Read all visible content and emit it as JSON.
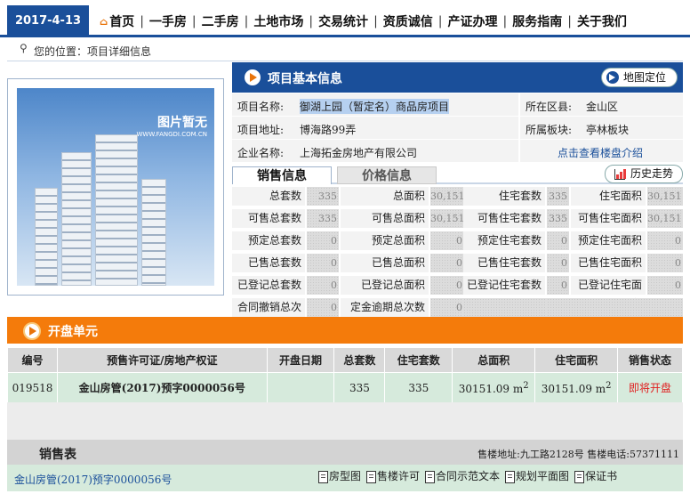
{
  "date": "2017-4-13",
  "nav": [
    "首页",
    "一手房",
    "二手房",
    "土地市场",
    "交易统计",
    "资质诚信",
    "产证办理",
    "服务指南",
    "关于我们"
  ],
  "breadcrumb": "您的位置：项目详细信息",
  "photo": {
    "caption": "图片暂无",
    "sub": "WWW.FANGDI.COM.CN"
  },
  "info": {
    "title": "项目基本信息",
    "map_btn": "地图定位",
    "rows": [
      {
        "l": "项目名称:",
        "v": "御湖上园（暂定名）商品房项目",
        "l2": "所在区县:",
        "v2": "金山区"
      },
      {
        "l": "项目地址:",
        "v": "博海路99弄",
        "l2": "所属板块:",
        "v2": "亭林板块"
      },
      {
        "l": "企业名称:",
        "v": "上海拓金房地产有限公司",
        "l2": "",
        "v2": "点击查看楼盘介绍"
      }
    ]
  },
  "tabs": {
    "sales": "销售信息",
    "price": "价格信息",
    "history": "历史走势"
  },
  "stats": [
    [
      [
        "总套数",
        "335"
      ],
      [
        "总面积",
        "30,151"
      ],
      [
        "住宅套数",
        "335"
      ],
      [
        "住宅面积",
        "30,151"
      ]
    ],
    [
      [
        "可售总套数",
        "335"
      ],
      [
        "可售总面积",
        "30,151"
      ],
      [
        "可售住宅套数",
        "335"
      ],
      [
        "可售住宅面积",
        "30,151"
      ]
    ],
    [
      [
        "预定总套数",
        "0"
      ],
      [
        "预定总面积",
        "0"
      ],
      [
        "预定住宅套数",
        "0"
      ],
      [
        "预定住宅面积",
        "0"
      ]
    ],
    [
      [
        "已售总套数",
        "0"
      ],
      [
        "已售总面积",
        "0"
      ],
      [
        "已售住宅套数",
        "0"
      ],
      [
        "已售住宅面积",
        "0"
      ]
    ],
    [
      [
        "已登记总套数",
        "0"
      ],
      [
        "已登记总面积",
        "0"
      ],
      [
        "已登记住宅套数",
        "0"
      ],
      [
        "已登记住宅面积",
        "0"
      ]
    ],
    [
      [
        "合同撤销总次数",
        "0"
      ],
      [
        "定金逾期总次数",
        "0"
      ]
    ]
  ],
  "opening": {
    "title": "开盘单元",
    "headers": [
      "编号",
      "预售许可证/房地产权证",
      "开盘日期",
      "总套数",
      "住宅套数",
      "总面积",
      "住宅面积",
      "销售状态"
    ],
    "row": {
      "id": "019518",
      "permit": "金山房管(2017)预字0000056号",
      "date": "",
      "total": "335",
      "res": "335",
      "area": "30151.09 m",
      "res_area": "30151.09 m",
      "sup": "2",
      "status": "即将开盘"
    }
  },
  "sales": {
    "title": "销售表",
    "addr": "售楼地址:九工路2128号 售楼电话:57371111"
  },
  "bottom": {
    "link": "金山房管(2017)预字0000056号",
    "docs": [
      "房型图",
      "售楼许可",
      "合同示范文本",
      "规划平面图",
      "保证书"
    ]
  }
}
